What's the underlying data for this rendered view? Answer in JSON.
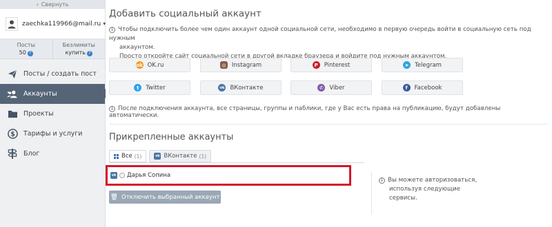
{
  "sidebar": {
    "collapse_label": "Свернуть",
    "user_email": "zaechka119966@mail.ru",
    "stats": {
      "posts_label": "Посты",
      "posts_value": "50",
      "unlimited_label": "Безлимиты",
      "unlimited_value": "купить"
    },
    "nav": [
      {
        "label": "Посты / создать пост",
        "icon": "paper-plane-icon"
      },
      {
        "label": "Аккаунты",
        "icon": "users-icon",
        "active": true
      },
      {
        "label": "Проекты",
        "icon": "folder-icon"
      },
      {
        "label": "Тарифы и услуги",
        "icon": "dollar-icon"
      },
      {
        "label": "Блог",
        "icon": "signpost-icon"
      }
    ]
  },
  "main": {
    "add_title": "Добавить социальный аккаунт",
    "info_line1": "Чтобы подключить более чем один аккаунт одной социальной сети, необходимо в первую очередь войти в социальную сеть под нужным",
    "info_line2": "аккаунтом.",
    "info_line3": "Просто откройте сайт социальной сети в другой вкладке браузера и войдите под нужным аккаунтом.",
    "networks": [
      {
        "label": "OK.ru",
        "icon": "ok-icon",
        "color": "#f59a23"
      },
      {
        "label": "Instagram",
        "icon": "instagram-icon",
        "color": "#8a5a44"
      },
      {
        "label": "Pinterest",
        "icon": "pinterest-icon",
        "color": "#cb2027"
      },
      {
        "label": "Telegram",
        "icon": "telegram-icon",
        "color": "#2ca5e0"
      },
      {
        "label": "Twitter",
        "icon": "twitter-icon",
        "color": "#2aa3ef"
      },
      {
        "label": "ВКонтакте",
        "icon": "vk-icon",
        "color": "#4c75a3"
      },
      {
        "label": "Viber",
        "icon": "viber-icon",
        "color": "#7d59a8"
      },
      {
        "label": "Facebook",
        "icon": "facebook-icon",
        "color": "#3b5998"
      }
    ],
    "info_after": "После подключения аккаунта, все страницы, группы и паблики, где у Вас есть права на публикацию, будут добавлены автоматически.",
    "attached_title": "Прикрепленные аккаунты",
    "tabs": [
      {
        "label": "Все",
        "count": "(1)"
      },
      {
        "label": "ВКонтакте",
        "count": "(1)"
      }
    ],
    "account_name": "Дарья Сопина",
    "disconnect_label": "Отключить выбранный аккаунт",
    "side_note_first": "Вы можете авторизоваться,",
    "side_note_rest": "используя следующие сервисы.",
    "highlight_color": "#d3162a"
  }
}
